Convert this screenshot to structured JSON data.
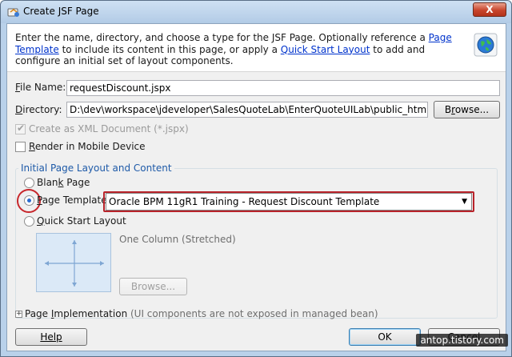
{
  "window": {
    "title": "Create JSF Page",
    "close_label": "X"
  },
  "header": {
    "desc_part1": "Enter the name, directory, and choose a type for the JSF Page. Optionally reference a ",
    "link_template": "Page Template",
    "desc_part2": " to include its content in this page, or apply a ",
    "link_quickstart": "Quick Start Layout",
    "desc_part3": " to add and configure an initial set of layout components."
  },
  "form": {
    "file_name_label_u": "F",
    "file_name_label_rest": "ile Name:",
    "file_name_value": "requestDiscount.jspx",
    "directory_label_u": "D",
    "directory_label_rest": "irectory:",
    "directory_value": "D:\\dev\\workspace\\jdeveloper\\SalesQuoteLab\\EnterQuoteUILab\\public_html",
    "browse_u": "r",
    "browse_pre": "B",
    "browse_post": "owse...",
    "xml_checkbox_label": "Create as XML Document (*.jspx)",
    "xml_checked": true,
    "mobile_u": "R",
    "mobile_rest": "ender in Mobile Device",
    "mobile_checked": false
  },
  "layout_group": {
    "title": "Initial Page Layout and Content",
    "blank_pre": "Blan",
    "blank_u": "k",
    "blank_post": " Page",
    "template_u": "P",
    "template_rest": "age Template",
    "template_selected": "Oracle BPM 11gR1 Training - Request Discount Template",
    "quick_u": "Q",
    "quick_rest": "uick Start Layout",
    "layout_name": "One Column (Stretched)",
    "browse2_label": "Browse...",
    "selected_option": "page-template"
  },
  "implementation": {
    "label_pre": "Page ",
    "label_u": "I",
    "label_post": "mplementation",
    "note": " (UI components are not exposed in managed bean)"
  },
  "footer": {
    "help_label": "Help",
    "ok_label": "OK",
    "cancel_label": "Cancel"
  },
  "watermark": "antop.tistory.com",
  "colors": {
    "link": "#0033cc",
    "highlight_red": "#b8232a",
    "group_title": "#1e5aa8"
  }
}
